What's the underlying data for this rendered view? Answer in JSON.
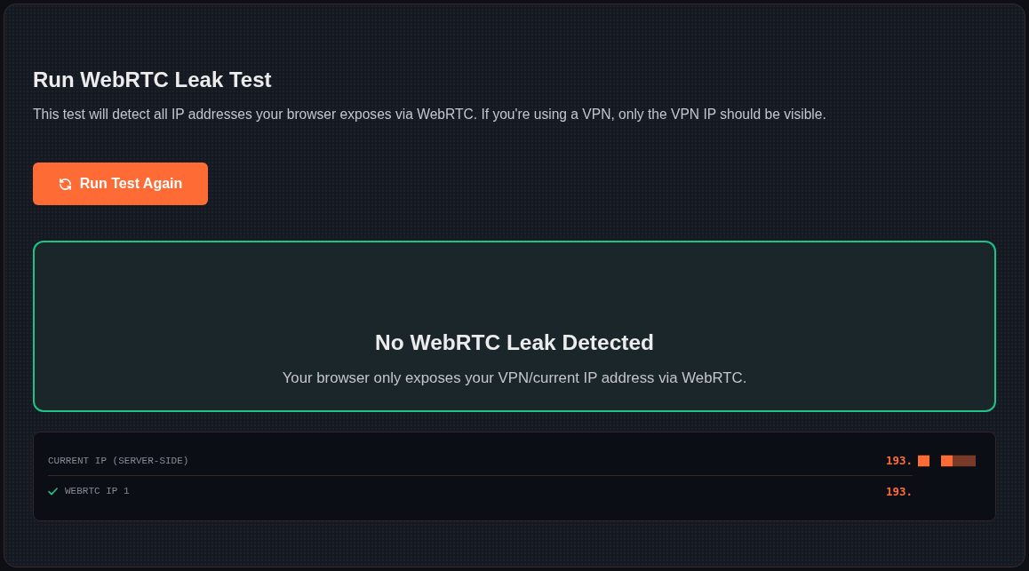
{
  "title": "Run WebRTC Leak Test",
  "description": "This test will detect all IP addresses your browser exposes via WebRTC. If you're using a VPN, only the VPN IP should be visible.",
  "run_button": {
    "label": "Run Test Again"
  },
  "result": {
    "kind": "safe",
    "title": "No WebRTC Leak Detected",
    "message": "Your browser only exposes your VPN/current IP address via WebRTC."
  },
  "ip_rows": [
    {
      "label": "CURRENT IP (SERVER-SIDE)",
      "value": "193.",
      "verified": false,
      "redacted": true
    },
    {
      "label": "WEBRTC IP 1",
      "value": "193.",
      "verified": true,
      "redacted": false
    }
  ]
}
